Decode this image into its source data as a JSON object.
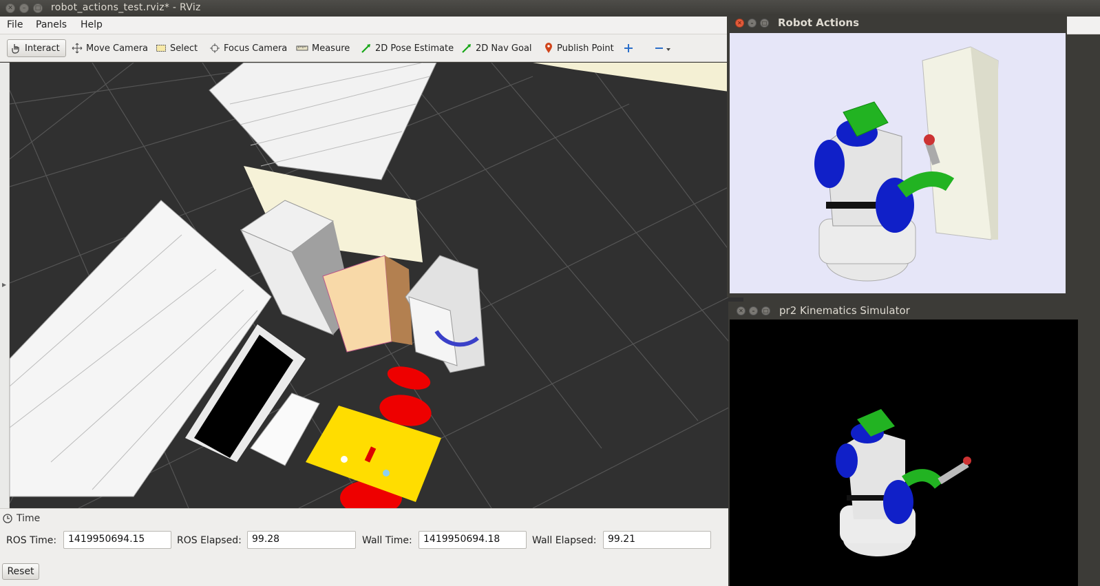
{
  "window": {
    "title": "robot_actions_test.rviz* - RViz"
  },
  "menu": [
    "File",
    "Panels",
    "Help"
  ],
  "toolbar": {
    "tools": [
      {
        "label": "Interact",
        "icon": "hand-pointer-icon"
      },
      {
        "label": "Move Camera",
        "icon": "move-arrows-icon"
      },
      {
        "label": "Select",
        "icon": "selection-rectangle-icon"
      },
      {
        "label": "Focus Camera",
        "icon": "crosshair-icon"
      },
      {
        "label": "Measure",
        "icon": "ruler-icon"
      },
      {
        "label": "2D Pose Estimate",
        "icon": "green-arrow-icon"
      },
      {
        "label": "2D Nav Goal",
        "icon": "green-arrow-icon"
      },
      {
        "label": "Publish Point",
        "icon": "map-pin-icon"
      }
    ],
    "active_tool": "Interact"
  },
  "time_panel": {
    "title": "Time",
    "ros_time_label": "ROS Time:",
    "ros_time": "1419950694.15",
    "ros_elapsed_label": "ROS Elapsed:",
    "ros_elapsed": "99.28",
    "wall_time_label": "Wall Time:",
    "wall_time": "1419950694.18",
    "wall_elapsed_label": "Wall Elapsed:",
    "wall_elapsed": "99.21",
    "reset_label": "Reset"
  },
  "robot_actions_window": {
    "title": "Robot Actions",
    "background": "#e6e6f8"
  },
  "kinematics_window": {
    "title": "pr2 Kinematics Simulator",
    "background": "#000000"
  },
  "colors": {
    "grid_background": "#303030",
    "robot_green": "#22b322",
    "robot_blue": "#1020c8",
    "robot_grey": "#e6e6e6",
    "chair_red": "#ee0000",
    "table_yellow": "#ffdd00"
  }
}
